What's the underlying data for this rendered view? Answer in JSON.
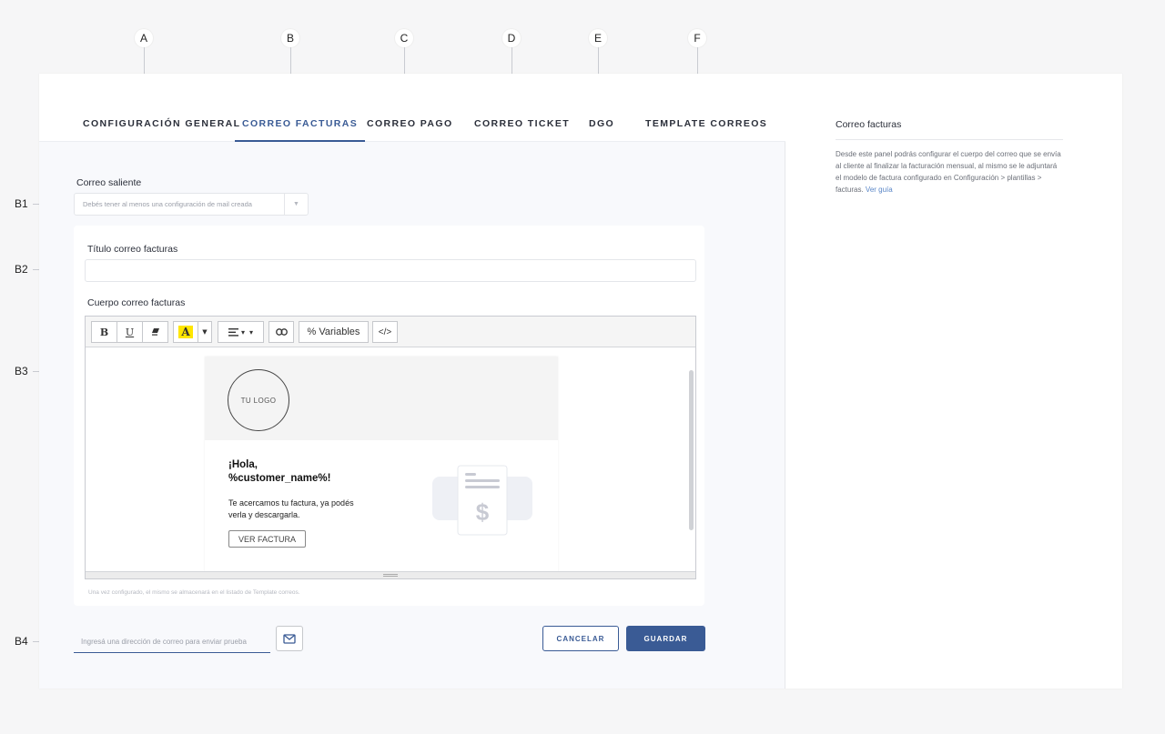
{
  "markers": {
    "top": [
      "A",
      "B",
      "C",
      "D",
      "E",
      "F"
    ],
    "side": [
      "B1",
      "B2",
      "B3",
      "B4"
    ]
  },
  "tabs": [
    {
      "label": "CONFIGURACIÓN GENERAL",
      "active": false
    },
    {
      "label": "CORREO FACTURAS",
      "active": true
    },
    {
      "label": "CORREO PAGO",
      "active": false
    },
    {
      "label": "CORREO TICKET",
      "active": false
    },
    {
      "label": "DGO",
      "active": false
    },
    {
      "label": "TEMPLATE CORREOS",
      "active": false
    }
  ],
  "form": {
    "outgoing_label": "Correo saliente",
    "outgoing_select_value": "Debés tener al menos una configuración de mail creada",
    "title_label": "Título correo facturas",
    "title_value": "",
    "body_label": "Cuerpo correo facturas",
    "note": "Una vez configurado, el mismo se almacenará en el listado de Template correos."
  },
  "toolbar": {
    "bold": "B",
    "underline": "U",
    "highlight": "A",
    "variables": "% Variables",
    "code": "</>"
  },
  "email_preview": {
    "logo_text": "TU LOGO",
    "greeting_line1": "¡Hola,",
    "greeting_line2": "%customer_name%!",
    "message": "Te acercamos tu factura, ya podés verla y descargarla.",
    "button": "VER FACTURA"
  },
  "footer": {
    "test_email_placeholder": "Ingresá una dirección de correo para enviar prueba",
    "cancel_label": "CANCELAR",
    "save_label": "GUARDAR"
  },
  "help": {
    "title": "Correo facturas",
    "body": "Desde este panel podrás configurar el cuerpo del correo que se envía al cliente al finalizar la facturación mensual, al mismo se le adjuntará el modelo de factura configurado en Configuración > plantillas > facturas.",
    "link": "Ver guía"
  },
  "colors": {
    "accent": "#3a5b95",
    "highlight_yellow": "#ffe600"
  }
}
